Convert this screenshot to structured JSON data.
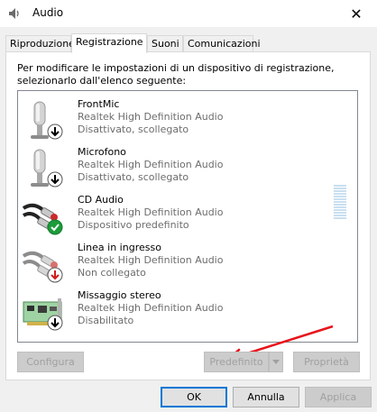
{
  "window": {
    "title": "Audio",
    "close_glyph": "✕"
  },
  "tabs": [
    {
      "label": "Riproduzione",
      "active": false
    },
    {
      "label": "Registrazione",
      "active": true
    },
    {
      "label": "Suoni",
      "active": false
    },
    {
      "label": "Comunicazioni",
      "active": false
    }
  ],
  "instructions": "Per modificare le impostazioni di un dispositivo di registrazione, selezionarlo dall'elenco seguente:",
  "devices": [
    {
      "name": "FrontMic",
      "driver": "Realtek High Definition Audio",
      "status": "Disattivato, scollegato",
      "icon": "microphone-icon",
      "badge": "down-arrow-badge"
    },
    {
      "name": "Microfono",
      "driver": "Realtek High Definition Audio",
      "status": "Disattivato, scollegato",
      "icon": "microphone-icon",
      "badge": "down-arrow-badge"
    },
    {
      "name": "CD Audio",
      "driver": "Realtek High Definition Audio",
      "status": "Dispositivo predefinito",
      "icon": "rca-cable-icon",
      "badge": "checkmark-badge"
    },
    {
      "name": "Linea in ingresso",
      "driver": "Realtek High Definition Audio",
      "status": "Non collegato",
      "icon": "rca-cable-icon",
      "badge": "red-down-arrow-badge"
    },
    {
      "name": "Missaggio stereo",
      "driver": "Realtek High Definition Audio",
      "status": "Disabilitato",
      "icon": "sound-card-icon",
      "badge": "down-arrow-badge"
    }
  ],
  "buttons": {
    "configure": "Configura",
    "default": "Predefinito",
    "properties": "Proprietà",
    "ok": "OK",
    "cancel": "Annulla",
    "apply": "Applica"
  },
  "colors": {
    "accent": "#0078d7",
    "annotation_arrow": "#e8141b",
    "default_badge": "#1c9b3a"
  }
}
